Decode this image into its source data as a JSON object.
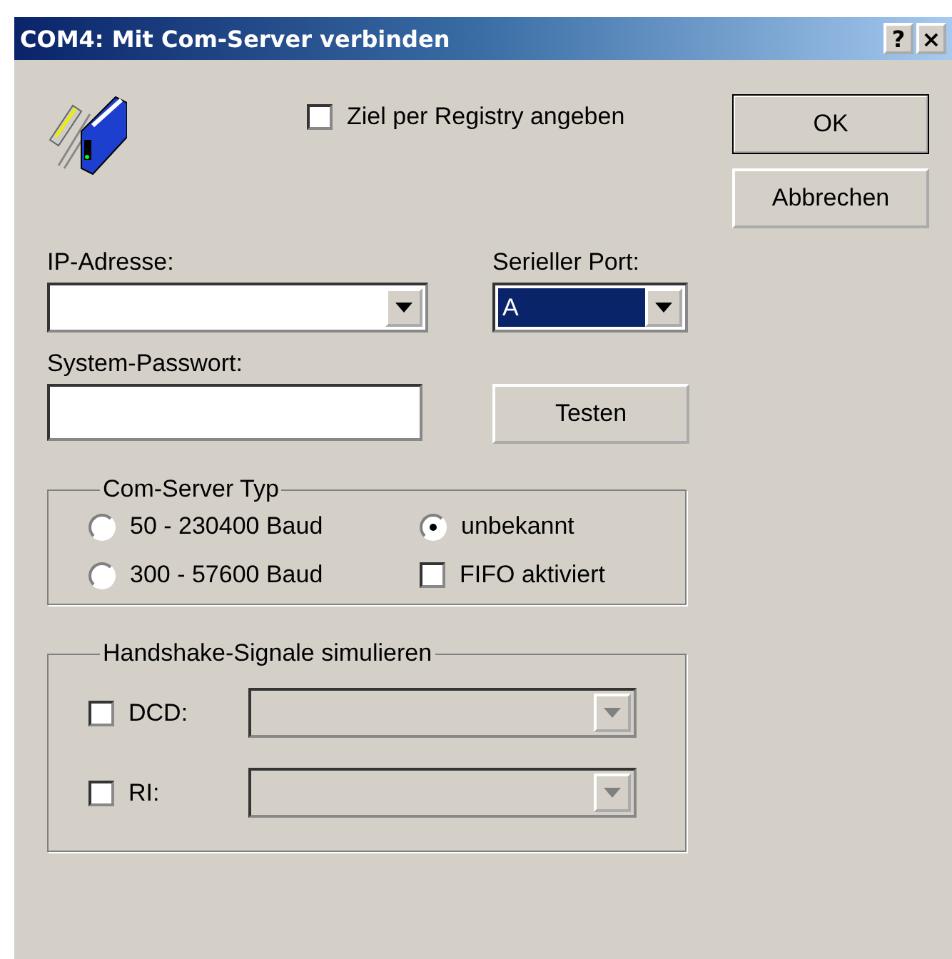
{
  "window": {
    "title": "COM4: Mit Com-Server verbinden",
    "title_buttons": [
      "?",
      "×"
    ]
  },
  "registry_checkbox": {
    "label": "Ziel per Registry angeben",
    "checked": false
  },
  "buttons": [
    {
      "label": "OK",
      "default": true
    },
    {
      "label": "Abbrechen",
      "default": false
    }
  ],
  "ip_address": {
    "label": "IP-Adresse:"
  },
  "serial_port": {
    "label": "Serieller Port:",
    "value": "A",
    "focused": true
  },
  "system_password": {
    "label": "System-Passwort:"
  },
  "test_button": {
    "label": "Testen"
  },
  "server_type": {
    "title": "Com-Server Typ",
    "options": [
      {
        "kind": "radio",
        "label": "50 - 230400 Baud",
        "checked": false
      },
      {
        "kind": "radio",
        "label": "unbekannt",
        "checked": true
      },
      {
        "kind": "radio",
        "label": "300 - 57600 Baud",
        "checked": false
      },
      {
        "kind": "checkbox",
        "label": "FIFO aktiviert",
        "checked": false
      }
    ]
  },
  "handshake": {
    "title": "Handshake-Signale simulieren",
    "signals": [
      {
        "label": "DCD:",
        "checked": false,
        "disabled": true
      },
      {
        "label": "RI:",
        "checked": false,
        "disabled": true
      }
    ]
  }
}
